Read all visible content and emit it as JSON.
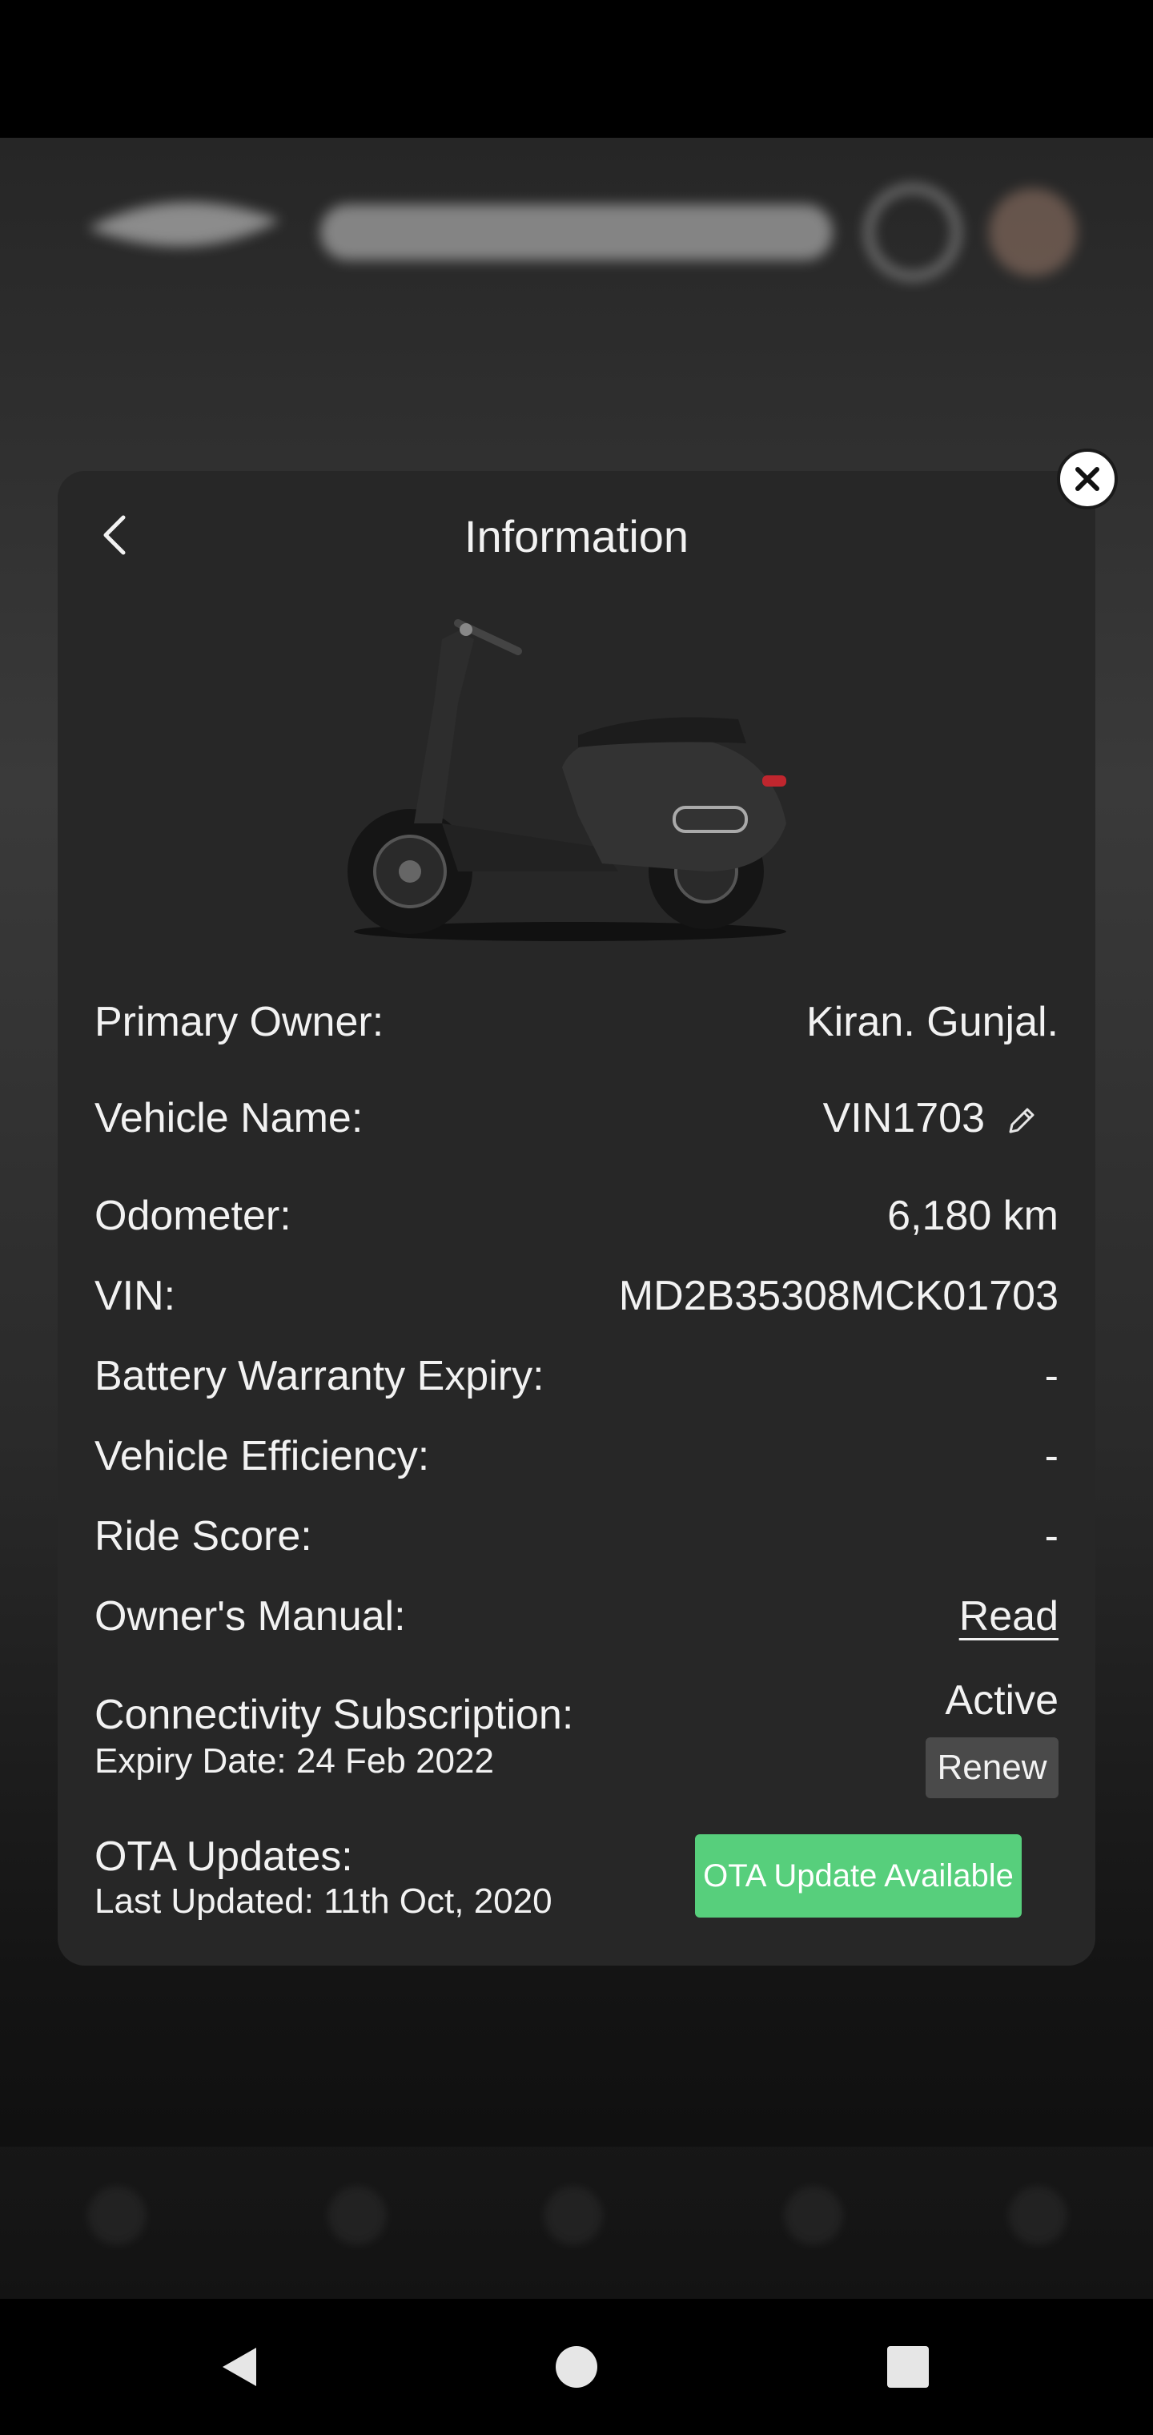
{
  "modal": {
    "title": "Information",
    "rows": {
      "primary_owner": {
        "label": "Primary Owner:",
        "value": "Kiran. Gunjal."
      },
      "vehicle_name": {
        "label": "Vehicle Name:",
        "value": "VIN1703"
      },
      "odometer": {
        "label": "Odometer:",
        "value": "6,180 km"
      },
      "vin": {
        "label": "VIN:",
        "value": "MD2B35308MCK01703"
      },
      "battery_warranty": {
        "label": "Battery Warranty Expiry:",
        "value": "-"
      },
      "vehicle_efficiency": {
        "label": "Vehicle Efficiency:",
        "value": "-"
      },
      "ride_score": {
        "label": "Ride Score:",
        "value": "-"
      },
      "owners_manual": {
        "label": "Owner's Manual:",
        "link": "Read"
      },
      "connectivity": {
        "label": "Connectivity Subscription:",
        "expiry": "Expiry Date: 24 Feb 2022",
        "status": "Active",
        "renew_label": "Renew"
      },
      "ota": {
        "label": "OTA Updates:",
        "last_updated": "Last Updated: 11th Oct, 2020",
        "button_label": "OTA Update Available"
      }
    }
  },
  "icons": {
    "close": "close-icon",
    "back": "chevron-left-icon",
    "edit": "pencil-icon",
    "scooter": "scooter-image"
  },
  "colors": {
    "modal_bg": "#272727",
    "accent_green": "#57cf7c",
    "renew_bg": "#4a4a4a"
  }
}
